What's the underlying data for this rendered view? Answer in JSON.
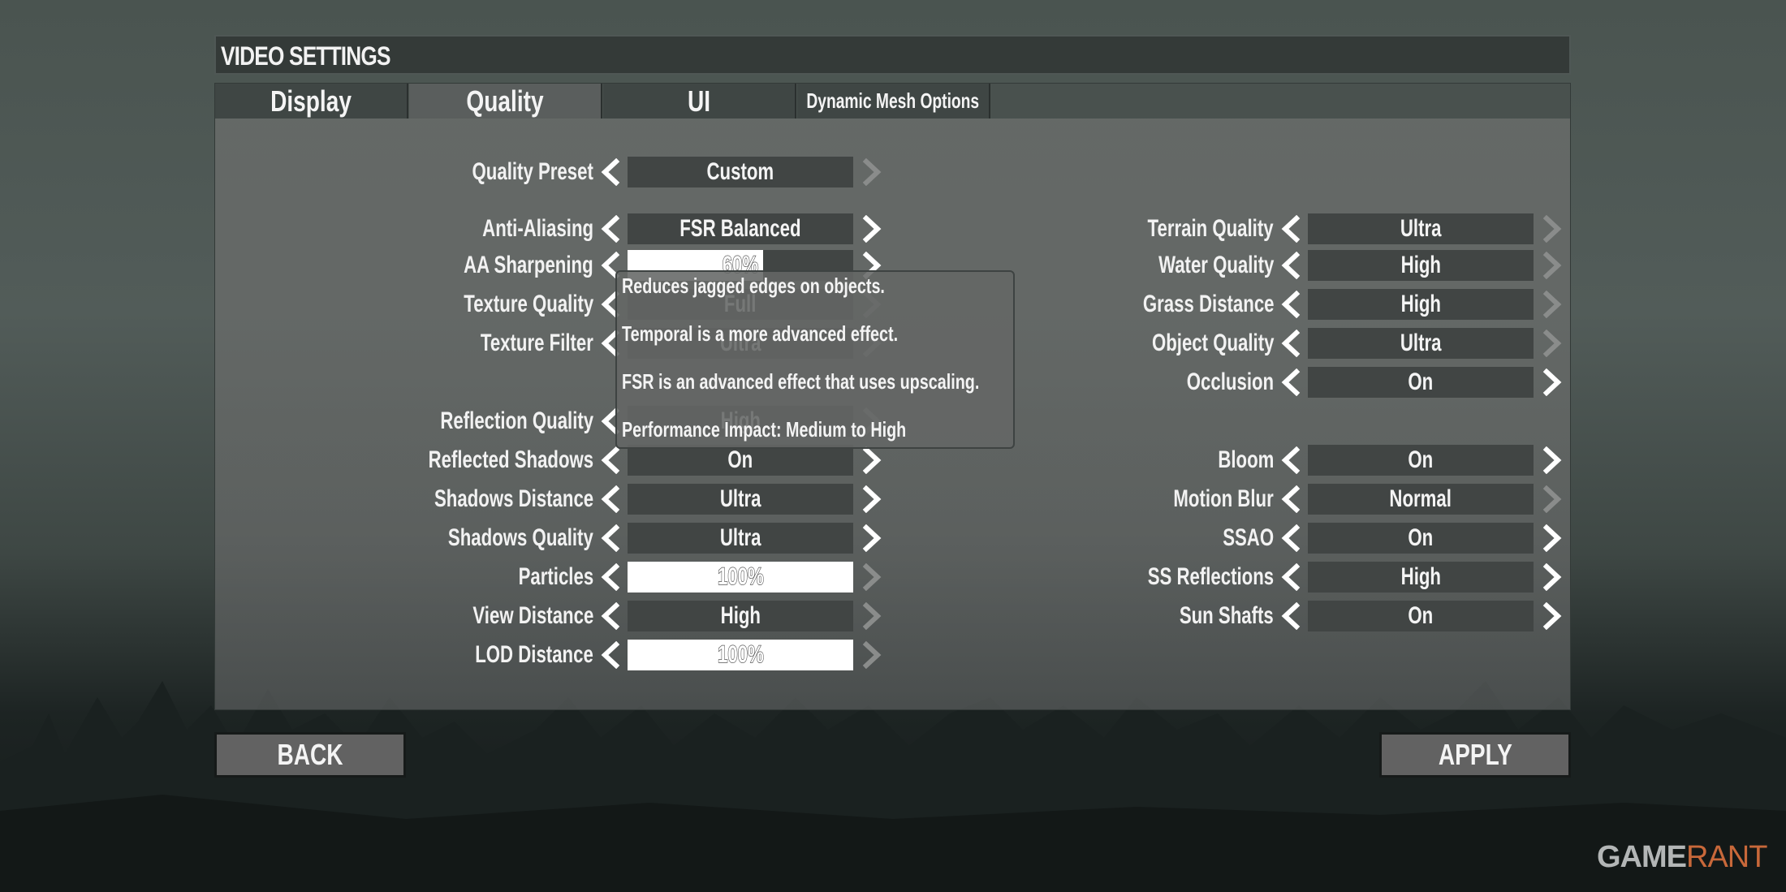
{
  "header": {
    "title": "VIDEO SETTINGS"
  },
  "tabs": [
    {
      "label": "Display",
      "active": false
    },
    {
      "label": "Quality",
      "active": true
    },
    {
      "label": "UI",
      "active": false
    },
    {
      "label": "Dynamic Mesh Options",
      "active": false
    }
  ],
  "left_settings": [
    {
      "label": "Quality Preset",
      "value": "Custom",
      "type": "select",
      "right_enabled": false
    },
    {
      "label": "Anti-Aliasing",
      "value": "FSR Balanced",
      "type": "select",
      "right_enabled": true
    },
    {
      "label": "AA Sharpening",
      "value": "60%",
      "type": "slider",
      "fill_percent": 60,
      "right_enabled": true
    },
    {
      "label": "Texture Quality",
      "value": "Full",
      "type": "select",
      "right_enabled": false
    },
    {
      "label": "Texture Filter",
      "value": "Ultra",
      "type": "select",
      "right_enabled": false
    },
    {
      "label": "Reflection Quality",
      "value": "High",
      "type": "select",
      "right_enabled": false
    },
    {
      "label": "Reflected Shadows",
      "value": "On",
      "type": "select",
      "right_enabled": true
    },
    {
      "label": "Shadows Distance",
      "value": "Ultra",
      "type": "select",
      "right_enabled": true
    },
    {
      "label": "Shadows Quality",
      "value": "Ultra",
      "type": "select",
      "right_enabled": true
    },
    {
      "label": "Particles",
      "value": "100%",
      "type": "slider",
      "fill_percent": 100,
      "right_enabled": false
    },
    {
      "label": "View Distance",
      "value": "High",
      "type": "select",
      "right_enabled": false
    },
    {
      "label": "LOD Distance",
      "value": "100%",
      "type": "slider",
      "fill_percent": 100,
      "right_enabled": false
    }
  ],
  "right_settings": [
    {
      "label": "Terrain Quality",
      "value": "Ultra",
      "type": "select",
      "right_enabled": false
    },
    {
      "label": "Water Quality",
      "value": "High",
      "type": "select",
      "right_enabled": false
    },
    {
      "label": "Grass Distance",
      "value": "High",
      "type": "select",
      "right_enabled": false
    },
    {
      "label": "Object Quality",
      "value": "Ultra",
      "type": "select",
      "right_enabled": false
    },
    {
      "label": "Occlusion",
      "value": "On",
      "type": "select",
      "right_enabled": true
    },
    {
      "label": "Bloom",
      "value": "On",
      "type": "select",
      "right_enabled": true
    },
    {
      "label": "Motion Blur",
      "value": "Normal",
      "type": "select",
      "right_enabled": false
    },
    {
      "label": "SSAO",
      "value": "On",
      "type": "select",
      "right_enabled": true
    },
    {
      "label": "SS Reflections",
      "value": "High",
      "type": "select",
      "right_enabled": true
    },
    {
      "label": "Sun Shafts",
      "value": "On",
      "type": "select",
      "right_enabled": true
    }
  ],
  "tooltip": {
    "lines": [
      "Reduces jagged edges on objects.",
      "Temporal is a more advanced effect.",
      "FSR is an advanced effect that uses upscaling.",
      "Performance Impact: Medium to High"
    ]
  },
  "buttons": {
    "back": "BACK",
    "apply": "APPLY"
  },
  "watermark": {
    "part1": "GAME",
    "part2": "RANT"
  },
  "colors": {
    "arrow_enabled": "#ffffff",
    "arrow_disabled": "#8a8c8b",
    "watermark_accent": "#c8683a"
  }
}
